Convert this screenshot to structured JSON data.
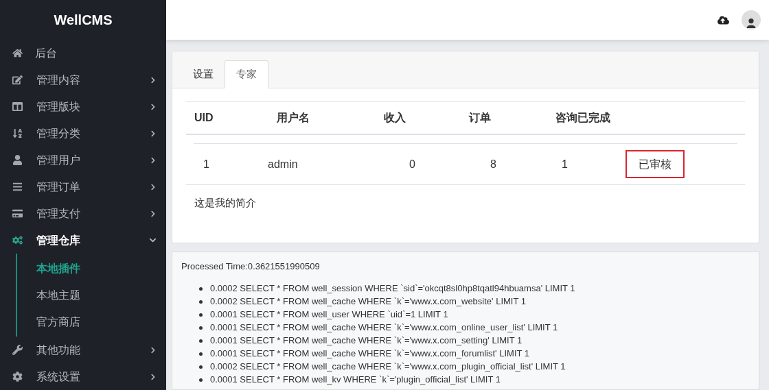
{
  "brand": "WellCMS",
  "sidebar": {
    "items": [
      {
        "label": "后台",
        "selected": false
      },
      {
        "label": "管理内容",
        "selected": false,
        "expanded": false
      },
      {
        "label": "管理版块",
        "selected": false,
        "expanded": false
      },
      {
        "label": "管理分类",
        "selected": false,
        "expanded": false
      },
      {
        "label": "管理用户",
        "selected": false,
        "expanded": false
      },
      {
        "label": "管理订单",
        "selected": false,
        "expanded": false
      },
      {
        "label": "管理支付",
        "selected": false,
        "expanded": false
      },
      {
        "label": "管理仓库",
        "selected": true,
        "expanded": true,
        "children": [
          {
            "label": "本地插件",
            "selected": true
          },
          {
            "label": "本地主题",
            "selected": false
          },
          {
            "label": "官方商店",
            "selected": false
          }
        ]
      },
      {
        "label": "其他功能",
        "selected": false,
        "expanded": false
      },
      {
        "label": "系统设置",
        "selected": false,
        "expanded": false
      }
    ]
  },
  "tabs": [
    {
      "label": "设置",
      "selected": false
    },
    {
      "label": "专家",
      "selected": true
    }
  ],
  "table": {
    "columns": [
      "UID",
      "用户名",
      "收入",
      "订单",
      "咨询已完成"
    ],
    "rows": [
      {
        "cells": [
          "1",
          "admin",
          "0",
          "8",
          "1"
        ],
        "status": "已审核"
      }
    ]
  },
  "intro": "这是我的简介",
  "debug": {
    "processed_time": "Processed Time:0.3621551990509",
    "queries": [
      "0.0002 SELECT * FROM well_session WHERE `sid`='okcqt8sl0hp8tqatl94hbuamsa' LIMIT 1",
      "0.0002 SELECT * FROM well_cache WHERE `k`='www.x.com_website' LIMIT 1",
      "0.0001 SELECT * FROM well_user WHERE `uid`=1 LIMIT 1",
      "0.0001 SELECT * FROM well_cache WHERE `k`='www.x.com_online_user_list' LIMIT 1",
      "0.0001 SELECT * FROM well_cache WHERE `k`='www.x.com_setting' LIMIT 1",
      "0.0001 SELECT * FROM well_cache WHERE `k`='www.x.com_forumlist' LIMIT 1",
      "0.0002 SELECT * FROM well_cache WHERE `k`='www.x.com_plugin_official_list' LIMIT 1",
      "0.0001 SELECT * FROM well_kv WHERE `k`='plugin_official_list' LIMIT 1"
    ]
  }
}
